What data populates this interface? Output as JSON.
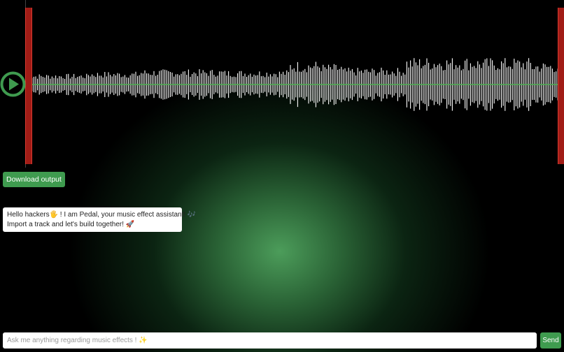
{
  "player": {
    "play_icon": "play-circle-icon",
    "accent_color": "#3f9b4f",
    "region_color": "#a11c16",
    "waveform_color": "#ffffff",
    "progress_line_color": "#4caf50"
  },
  "actions": {
    "download_label": "Download output"
  },
  "chat": {
    "messages": [
      {
        "role": "assistant",
        "line1": "Hello hackers🖐 ! I am Pedal, your music effect assistant! 🎶",
        "line2": "Import a track and let's build together! 🚀"
      }
    ]
  },
  "composer": {
    "placeholder": "Ask me anything regarding music effects ! ✨",
    "send_label": "Send"
  }
}
